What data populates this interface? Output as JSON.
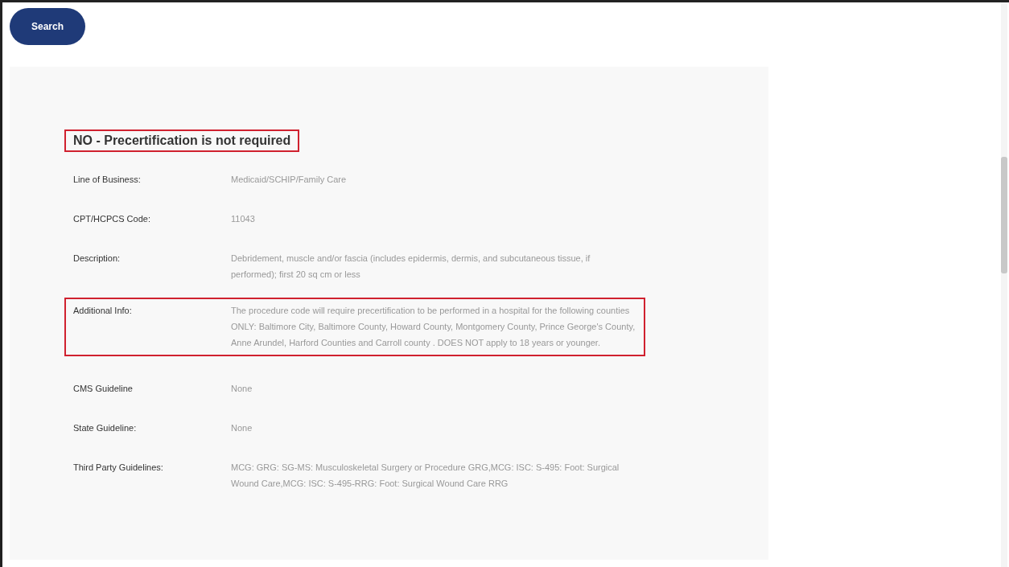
{
  "search_button": {
    "label": "Search"
  },
  "result": {
    "heading": "NO - Precertification is not required",
    "highlighted": true,
    "rows": [
      {
        "label": "Line of Business:",
        "value": "Medicaid/SCHIP/Family Care",
        "highlighted": false
      },
      {
        "label": "CPT/HCPCS Code:",
        "value": "11043",
        "highlighted": false
      },
      {
        "label": "Description:",
        "value": "Debridement, muscle and/or fascia (includes epidermis, dermis, and subcutaneous tissue, if performed); first 20 sq cm or less",
        "highlighted": false
      },
      {
        "label": "Additional Info:",
        "value": "The procedure code will require precertification to be performed in a hospital for the following counties ONLY: Baltimore City, Baltimore County, Howard County, Montgomery County, Prince George's County, Anne Arundel, Harford Counties and Carroll county . DOES NOT apply to 18 years or younger.",
        "highlighted": true
      },
      {
        "label": "CMS Guideline",
        "value": "None",
        "highlighted": false
      },
      {
        "label": "State Guideline:",
        "value": "None",
        "highlighted": false
      },
      {
        "label": "Third Party Guidelines:",
        "value": "MCG: GRG: SG-MS: Musculoskeletal Surgery or Procedure GRG,MCG: ISC: S-495: Foot: Surgical Wound Care,MCG: ISC: S-495-RRG: Foot: Surgical Wound Care RRG",
        "highlighted": false
      }
    ]
  }
}
